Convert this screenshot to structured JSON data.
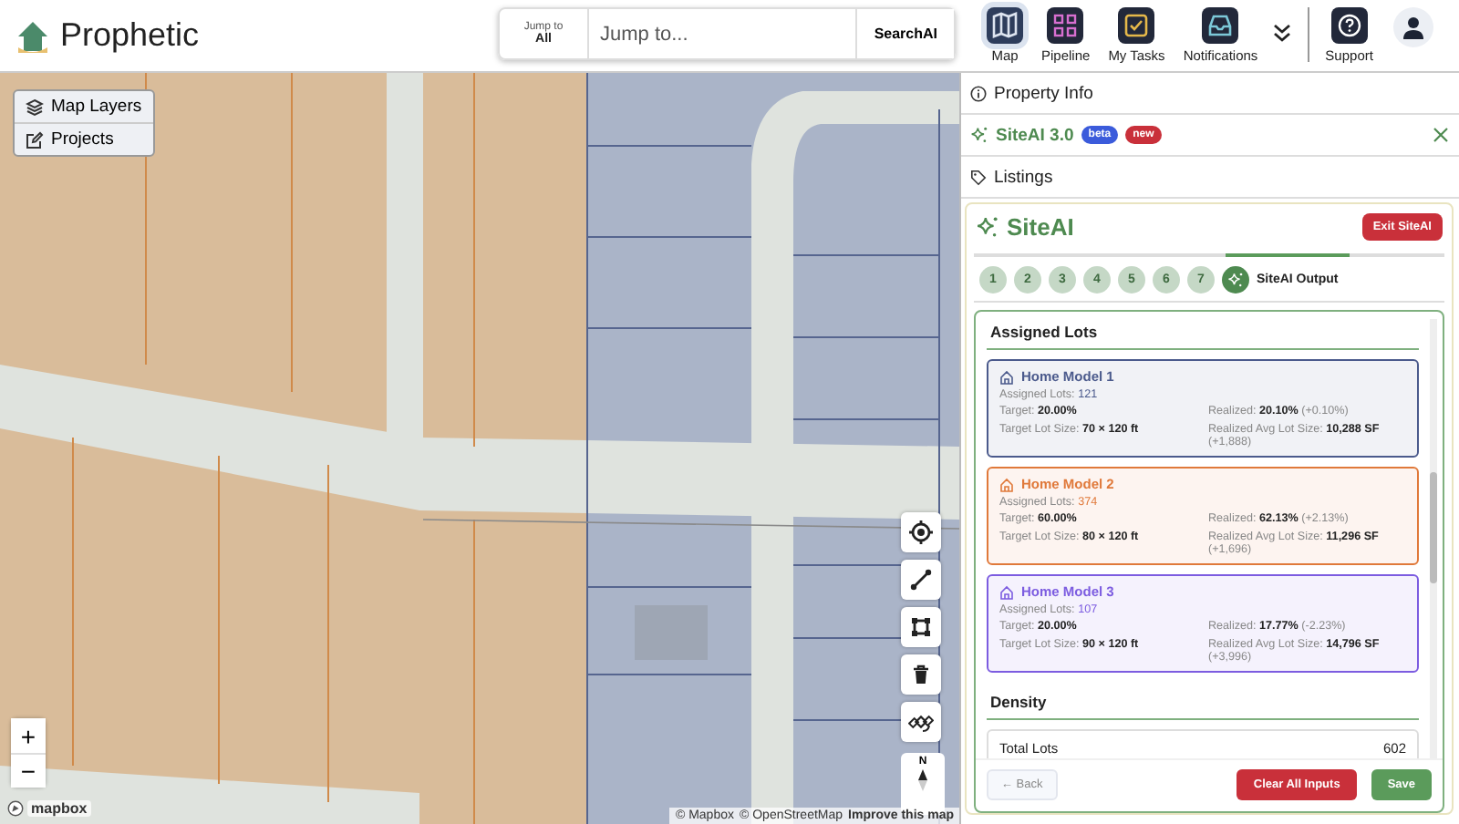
{
  "header": {
    "app_name": "Prophetic",
    "jump_scope_label": "Jump to",
    "jump_scope_value": "All",
    "search": {
      "placeholder": "Jump to..."
    },
    "search_button": "SearchAI",
    "nav": [
      {
        "kind": "map",
        "label": "Map",
        "selected": true
      },
      {
        "kind": "pipeline",
        "label": "Pipeline",
        "selected": false
      },
      {
        "kind": "tasks",
        "label": "My Tasks",
        "selected": false
      },
      {
        "kind": "notifications",
        "label": "Notifications",
        "selected": false
      }
    ],
    "support": "Support"
  },
  "map": {
    "layer_menu": [
      "Map Layers",
      "Projects"
    ],
    "zoom_in": "+",
    "zoom_out": "−",
    "compass": "N",
    "logo": "mapbox",
    "attribution": [
      "© Mapbox",
      "© OpenStreetMap"
    ],
    "improve_link": "Improve this map"
  },
  "panel": {
    "sections": [
      {
        "kind": "info",
        "label": "Property Info"
      },
      {
        "kind": "siteai",
        "label": "SiteAI 3.0",
        "badges": [
          "beta",
          "new"
        ]
      },
      {
        "kind": "tag",
        "label": "Listings"
      }
    ],
    "siteai": {
      "title": "SiteAI",
      "exit_button": "Exit SiteAI",
      "steps": [
        {
          "label": "1",
          "selected": false
        },
        {
          "label": "2",
          "selected": false
        },
        {
          "label": "3",
          "selected": false
        },
        {
          "label": "4",
          "selected": false
        },
        {
          "label": "5",
          "selected": false
        },
        {
          "label": "6",
          "selected": false
        },
        {
          "label": "7",
          "selected": false
        }
      ],
      "output_step": {
        "label": "SiteAI Output",
        "selected": true
      },
      "assigned_heading": "Assigned Lots",
      "models": [
        {
          "name": "Home Model 1",
          "color": "#4b5a8c",
          "assigned_label": "Assigned Lots:",
          "assigned": "121",
          "target": "Target: **20.00%**",
          "realized": "Realized: **20.10%** (+0.10%)",
          "target_size": "Target Lot Size: **70 × 120 ft**",
          "realized_size": "Realized Avg Lot Size: **10,288 SF** (+1,888)"
        },
        {
          "name": "Home Model 2",
          "color": "#e0793a",
          "assigned_label": "Assigned Lots:",
          "assigned": "374",
          "target": "Target: **60.00%**",
          "realized": "Realized: **62.13%** (+2.13%)",
          "target_size": "Target Lot Size: **80 × 120 ft**",
          "realized_size": "Realized Avg Lot Size: **11,296 SF** (+1,696)"
        },
        {
          "name": "Home Model 3",
          "color": "#7c5ce0",
          "assigned_label": "Assigned Lots:",
          "assigned": "107",
          "target": "Target: **20.00%**",
          "realized": "Realized: **17.77%** (-2.23%)",
          "target_size": "Target Lot Size: **90 × 120 ft**",
          "realized_size": "Realized Avg Lot Size: **14,796 SF** (+3,996)"
        }
      ],
      "density_heading": "Density",
      "density": [
        {
          "label": "Total Lots",
          "value": "602"
        }
      ],
      "back_button": "← Back",
      "clear_button": "Clear All Inputs",
      "save_button": "Save"
    }
  }
}
